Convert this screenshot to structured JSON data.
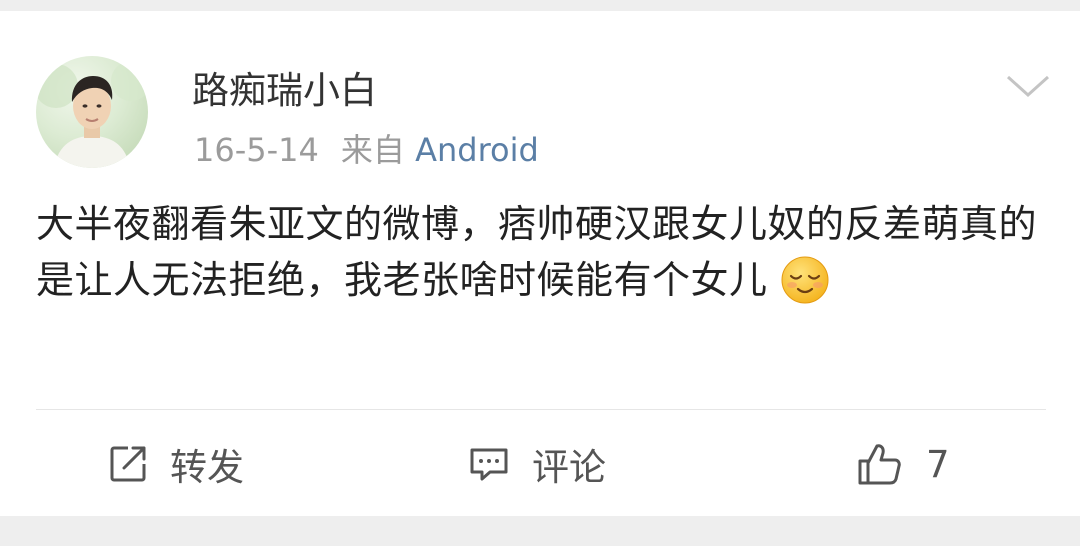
{
  "post": {
    "author": "路痴瑞小白",
    "date": "16-5-14",
    "source_prefix": "来自",
    "source_name": "Android",
    "text": "大半夜翻看朱亚文的微博，痞帅硬汉跟女儿奴的反差萌真的是让人无法拒绝，我老张啥时候能有个女儿",
    "emoji": "relieved-face-emoji"
  },
  "actions": {
    "repost_label": "转发",
    "comment_label": "评论",
    "like_count": "7"
  },
  "icons": {
    "menu": "chevron-down-icon",
    "repost": "repost-icon",
    "comment": "comment-icon",
    "like": "thumbs-up-icon"
  },
  "colors": {
    "link": "#5b7fa6",
    "meta_text": "#9b9b9b",
    "body_text": "#222222"
  }
}
